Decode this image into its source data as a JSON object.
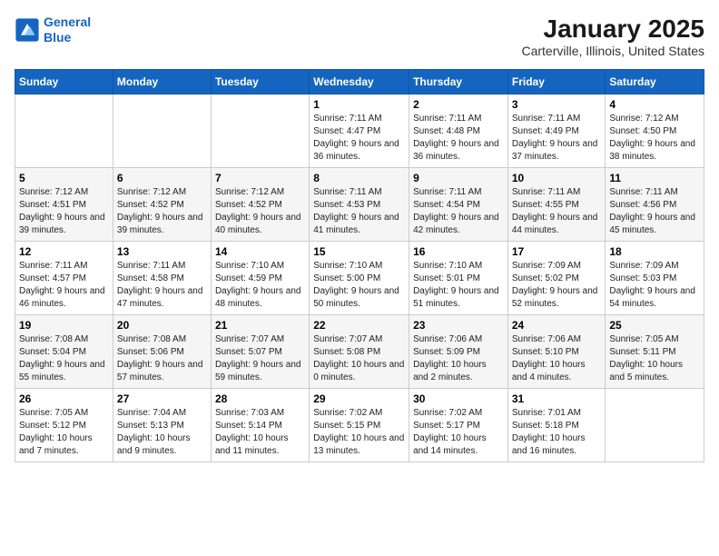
{
  "logo": {
    "line1": "General",
    "line2": "Blue"
  },
  "title": "January 2025",
  "subtitle": "Carterville, Illinois, United States",
  "days_of_week": [
    "Sunday",
    "Monday",
    "Tuesday",
    "Wednesday",
    "Thursday",
    "Friday",
    "Saturday"
  ],
  "weeks": [
    [
      {
        "day": "",
        "info": ""
      },
      {
        "day": "",
        "info": ""
      },
      {
        "day": "",
        "info": ""
      },
      {
        "day": "1",
        "info": "Sunrise: 7:11 AM\nSunset: 4:47 PM\nDaylight: 9 hours and 36 minutes."
      },
      {
        "day": "2",
        "info": "Sunrise: 7:11 AM\nSunset: 4:48 PM\nDaylight: 9 hours and 36 minutes."
      },
      {
        "day": "3",
        "info": "Sunrise: 7:11 AM\nSunset: 4:49 PM\nDaylight: 9 hours and 37 minutes."
      },
      {
        "day": "4",
        "info": "Sunrise: 7:12 AM\nSunset: 4:50 PM\nDaylight: 9 hours and 38 minutes."
      }
    ],
    [
      {
        "day": "5",
        "info": "Sunrise: 7:12 AM\nSunset: 4:51 PM\nDaylight: 9 hours and 39 minutes."
      },
      {
        "day": "6",
        "info": "Sunrise: 7:12 AM\nSunset: 4:52 PM\nDaylight: 9 hours and 39 minutes."
      },
      {
        "day": "7",
        "info": "Sunrise: 7:12 AM\nSunset: 4:52 PM\nDaylight: 9 hours and 40 minutes."
      },
      {
        "day": "8",
        "info": "Sunrise: 7:11 AM\nSunset: 4:53 PM\nDaylight: 9 hours and 41 minutes."
      },
      {
        "day": "9",
        "info": "Sunrise: 7:11 AM\nSunset: 4:54 PM\nDaylight: 9 hours and 42 minutes."
      },
      {
        "day": "10",
        "info": "Sunrise: 7:11 AM\nSunset: 4:55 PM\nDaylight: 9 hours and 44 minutes."
      },
      {
        "day": "11",
        "info": "Sunrise: 7:11 AM\nSunset: 4:56 PM\nDaylight: 9 hours and 45 minutes."
      }
    ],
    [
      {
        "day": "12",
        "info": "Sunrise: 7:11 AM\nSunset: 4:57 PM\nDaylight: 9 hours and 46 minutes."
      },
      {
        "day": "13",
        "info": "Sunrise: 7:11 AM\nSunset: 4:58 PM\nDaylight: 9 hours and 47 minutes."
      },
      {
        "day": "14",
        "info": "Sunrise: 7:10 AM\nSunset: 4:59 PM\nDaylight: 9 hours and 48 minutes."
      },
      {
        "day": "15",
        "info": "Sunrise: 7:10 AM\nSunset: 5:00 PM\nDaylight: 9 hours and 50 minutes."
      },
      {
        "day": "16",
        "info": "Sunrise: 7:10 AM\nSunset: 5:01 PM\nDaylight: 9 hours and 51 minutes."
      },
      {
        "day": "17",
        "info": "Sunrise: 7:09 AM\nSunset: 5:02 PM\nDaylight: 9 hours and 52 minutes."
      },
      {
        "day": "18",
        "info": "Sunrise: 7:09 AM\nSunset: 5:03 PM\nDaylight: 9 hours and 54 minutes."
      }
    ],
    [
      {
        "day": "19",
        "info": "Sunrise: 7:08 AM\nSunset: 5:04 PM\nDaylight: 9 hours and 55 minutes."
      },
      {
        "day": "20",
        "info": "Sunrise: 7:08 AM\nSunset: 5:06 PM\nDaylight: 9 hours and 57 minutes."
      },
      {
        "day": "21",
        "info": "Sunrise: 7:07 AM\nSunset: 5:07 PM\nDaylight: 9 hours and 59 minutes."
      },
      {
        "day": "22",
        "info": "Sunrise: 7:07 AM\nSunset: 5:08 PM\nDaylight: 10 hours and 0 minutes."
      },
      {
        "day": "23",
        "info": "Sunrise: 7:06 AM\nSunset: 5:09 PM\nDaylight: 10 hours and 2 minutes."
      },
      {
        "day": "24",
        "info": "Sunrise: 7:06 AM\nSunset: 5:10 PM\nDaylight: 10 hours and 4 minutes."
      },
      {
        "day": "25",
        "info": "Sunrise: 7:05 AM\nSunset: 5:11 PM\nDaylight: 10 hours and 5 minutes."
      }
    ],
    [
      {
        "day": "26",
        "info": "Sunrise: 7:05 AM\nSunset: 5:12 PM\nDaylight: 10 hours and 7 minutes."
      },
      {
        "day": "27",
        "info": "Sunrise: 7:04 AM\nSunset: 5:13 PM\nDaylight: 10 hours and 9 minutes."
      },
      {
        "day": "28",
        "info": "Sunrise: 7:03 AM\nSunset: 5:14 PM\nDaylight: 10 hours and 11 minutes."
      },
      {
        "day": "29",
        "info": "Sunrise: 7:02 AM\nSunset: 5:15 PM\nDaylight: 10 hours and 13 minutes."
      },
      {
        "day": "30",
        "info": "Sunrise: 7:02 AM\nSunset: 5:17 PM\nDaylight: 10 hours and 14 minutes."
      },
      {
        "day": "31",
        "info": "Sunrise: 7:01 AM\nSunset: 5:18 PM\nDaylight: 10 hours and 16 minutes."
      },
      {
        "day": "",
        "info": ""
      }
    ]
  ]
}
